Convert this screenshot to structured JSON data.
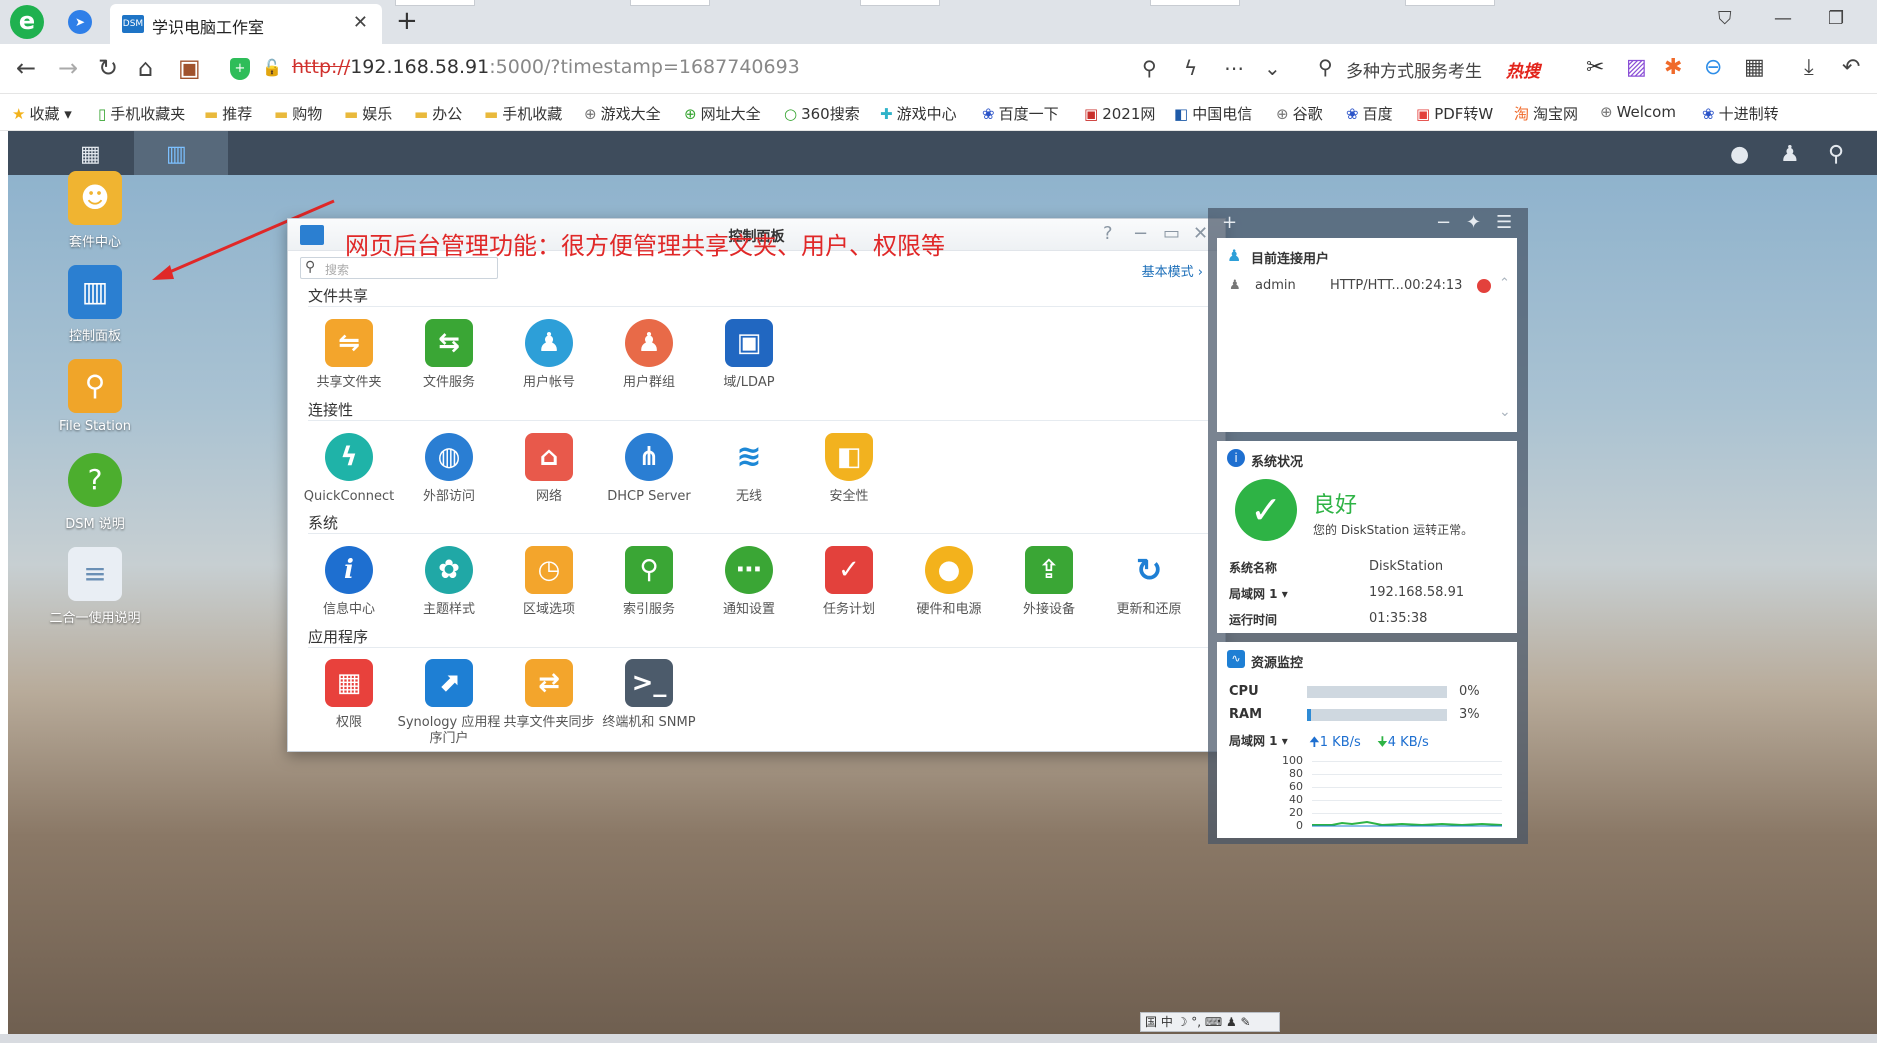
{
  "browser": {
    "tab_title": "学识电脑工作室",
    "tab_favicon": "DSM",
    "url_scheme": "http://",
    "url_host": "192.168.58.91",
    "url_rest": ":5000/?timestamp=1687740693",
    "search_text": "多种方式服务考生",
    "search_hot": "热搜"
  },
  "bookmarks": [
    {
      "label": "收藏",
      "icon": "star-icon"
    },
    {
      "label": "手机收藏夹",
      "icon": "phone-icon"
    },
    {
      "label": "推荐",
      "icon": "folder-icon"
    },
    {
      "label": "购物",
      "icon": "folder-icon"
    },
    {
      "label": "娱乐",
      "icon": "folder-icon"
    },
    {
      "label": "办公",
      "icon": "folder-icon"
    },
    {
      "label": "手机收藏",
      "icon": "folder-icon"
    },
    {
      "label": "游戏大全",
      "icon": "globe-icon"
    },
    {
      "label": "网址大全",
      "icon": "plus-circle-icon"
    },
    {
      "label": "360搜索",
      "icon": "search-icon"
    },
    {
      "label": "游戏中心",
      "icon": "game-icon"
    },
    {
      "label": "百度一下",
      "icon": "paw-icon"
    },
    {
      "label": "2021网",
      "icon": "page-icon"
    },
    {
      "label": "中国电信",
      "icon": "telecom-icon"
    },
    {
      "label": "谷歌",
      "icon": "globe-icon"
    },
    {
      "label": "百度",
      "icon": "paw-icon"
    },
    {
      "label": "PDF转W",
      "icon": "pdf-icon"
    },
    {
      "label": "淘宝网",
      "icon": "taobao-icon"
    },
    {
      "label": "Welcom",
      "icon": "globe-icon"
    },
    {
      "label": "十进制转",
      "icon": "paw-icon"
    }
  ],
  "desktop": [
    {
      "label": "套件中心",
      "color": "#f0b431"
    },
    {
      "label": "控制面板",
      "color": "#2b7fd1"
    },
    {
      "label": "File Station",
      "color": "#f0a529"
    },
    {
      "label": "DSM 说明",
      "color": "#4cae2e"
    },
    {
      "label": "二合一使用说明",
      "color": "#e9eef4"
    }
  ],
  "control_panel": {
    "title": "控制面板",
    "search_placeholder": "搜索",
    "basic_mode": "基本模式",
    "annotation": "网页后台管理功能：很方便管理共享文夹、用户、权限等",
    "sections": [
      {
        "title": "文件共享",
        "items": [
          {
            "label": "共享文件夹",
            "icon": "shared-folder-icon",
            "color": "#f3a52c"
          },
          {
            "label": "文件服务",
            "icon": "file-services-icon",
            "color": "#3aa635"
          },
          {
            "label": "用户帐号",
            "icon": "user-icon",
            "color": "#2d9fd8"
          },
          {
            "label": "用户群组",
            "icon": "group-icon",
            "color": "#e86a48"
          },
          {
            "label": "域/LDAP",
            "icon": "ldap-icon",
            "color": "#2167c1"
          }
        ]
      },
      {
        "title": "连接性",
        "items": [
          {
            "label": "QuickConnect",
            "icon": "quickconnect-icon",
            "color": "#1fb3a8"
          },
          {
            "label": "外部访问",
            "icon": "globe-icon",
            "color": "#2a7ed3"
          },
          {
            "label": "网络",
            "icon": "network-icon",
            "color": "#e8594b"
          },
          {
            "label": "DHCP Server",
            "icon": "dhcp-icon",
            "color": "#2a7ed3"
          },
          {
            "label": "无线",
            "icon": "wifi-icon",
            "color": "#1d88d6"
          },
          {
            "label": "安全性",
            "icon": "shield-icon",
            "color": "#f2b21f"
          }
        ]
      },
      {
        "title": "系统",
        "items": [
          {
            "label": "信息中心",
            "icon": "info-icon",
            "color": "#1e6fd0"
          },
          {
            "label": "主题样式",
            "icon": "palette-icon",
            "color": "#20a8a6"
          },
          {
            "label": "区域选项",
            "icon": "region-icon",
            "color": "#f3a52c"
          },
          {
            "label": "索引服务",
            "icon": "index-icon",
            "color": "#3aa635"
          },
          {
            "label": "通知设置",
            "icon": "chat-icon",
            "color": "#3aa635"
          },
          {
            "label": "任务计划",
            "icon": "calendar-icon",
            "color": "#e3413c"
          },
          {
            "label": "硬件和电源",
            "icon": "bulb-icon",
            "color": "#f3b21c"
          },
          {
            "label": "外接设备",
            "icon": "upload-icon",
            "color": "#3aa635"
          },
          {
            "label": "更新和还原",
            "icon": "refresh-icon",
            "color": "#1e7fd4"
          }
        ]
      },
      {
        "title": "应用程序",
        "items": [
          {
            "label": "权限",
            "icon": "lock-grid-icon",
            "color": "#e8413c"
          },
          {
            "label": "Synology 应用程序门户",
            "icon": "portal-icon",
            "color": "#1e7fd4"
          },
          {
            "label": "共享文件夹同步",
            "icon": "sync-folder-icon",
            "color": "#f3a52c"
          },
          {
            "label": "终端机和 SNMP",
            "icon": "terminal-icon",
            "color": "#4c5b6b"
          }
        ]
      }
    ]
  },
  "widgets": {
    "connected": {
      "title": "目前连接用户",
      "user": "admin",
      "protocol": "HTTP/HTT...",
      "time": "00:24:13"
    },
    "health": {
      "title": "系统状况",
      "status": "良好",
      "message": "您的 DiskStation 运转正常。",
      "rows": [
        {
          "label": "系统名称",
          "value": "DiskStation"
        },
        {
          "label": "局域网 1",
          "value": "192.168.58.91"
        },
        {
          "label": "运行时间",
          "value": "01:35:38"
        }
      ]
    },
    "monitor": {
      "title": "资源监控",
      "cpu_label": "CPU",
      "cpu_value": "0%",
      "cpu_fraction": 0.0,
      "ram_label": "RAM",
      "ram_value": "3%",
      "ram_fraction": 0.03,
      "lan_label": "局域网 1",
      "upload": "1 KB/s",
      "download": "4 KB/s",
      "y_ticks": [
        "100",
        "80",
        "60",
        "40",
        "20",
        "0"
      ]
    }
  },
  "ime": "国 中 ☽ °, ⌨ ♟ ✎"
}
